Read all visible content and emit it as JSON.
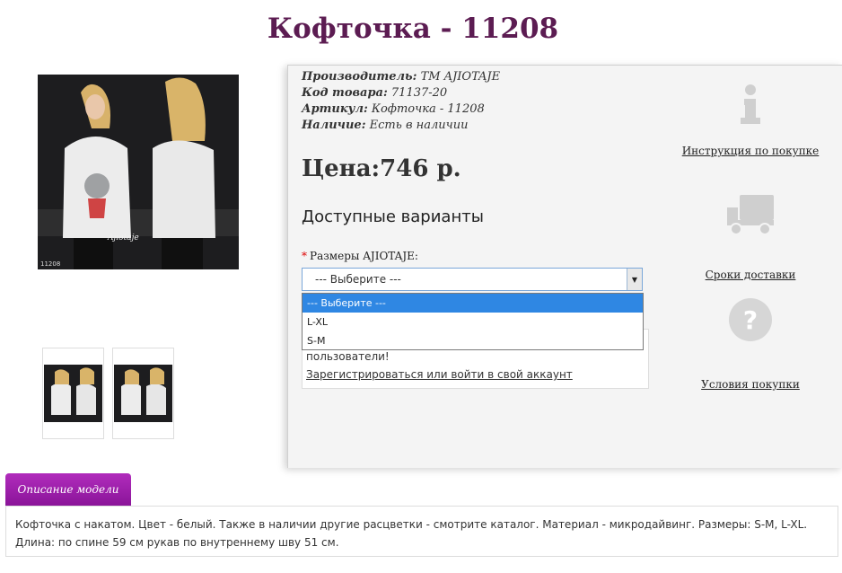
{
  "product": {
    "title": "Кофточка - 11208",
    "photo_code": "11208",
    "info": {
      "manufacturer_label": "Производитель:",
      "manufacturer_value": "ТМ AJIOTAJE",
      "code_label": "Код товара:",
      "code_value": "71137-20",
      "article_label": "Артикул:",
      "article_value": "Кофточка - 11208",
      "stock_label": "Наличие:",
      "stock_value": "Есть в наличии"
    },
    "price": "Цена:746 р.",
    "variants_title": "Доступные варианты",
    "size": {
      "required_mark": "*",
      "label": "Размеры AJIOTAJE:",
      "selected": "--- Выберите ---",
      "options": [
        "--- Выберите ---",
        "L-XL",
        "S-M"
      ]
    },
    "register": {
      "text": "пользователи!",
      "link": "Зарегистрироваться или войти в свой аккаунт"
    }
  },
  "sidebar": {
    "instruction_link": "Инструкция по покупке",
    "delivery_link": "Сроки доставки",
    "terms_link": "Условия покупки"
  },
  "description": {
    "tab_label": "Описание модели",
    "text": "Кофточка с накатом. Цвет - белый. Также в наличии другие расцветки - смотрите каталог. Материал - микродайвинг. Размеры: S-M, L-XL. Длина: по спине 59 см рукав по внутреннему шву 51 см."
  },
  "colors": {
    "title": "#5c1c52",
    "tab": "#9b1aa8",
    "dropdown_selected": "#2f87e3"
  }
}
